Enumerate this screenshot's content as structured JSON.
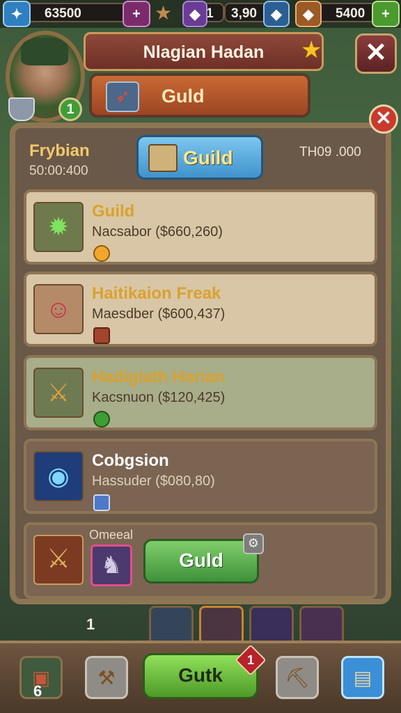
{
  "topbar": {
    "resources": [
      {
        "value": "63500",
        "icon": "gem-icon",
        "plus": "+"
      },
      {
        "value": "1",
        "icon": "amethyst-icon"
      },
      {
        "value": "3,90",
        "icon": "sapphire-icon"
      },
      {
        "value": "5400",
        "icon": "gold-crystal-icon",
        "plus": "+"
      }
    ]
  },
  "header": {
    "title": "Nlagian Hadan",
    "close": "✕"
  },
  "player": {
    "level": "1"
  },
  "tab": {
    "label": "Guld"
  },
  "guild_info": {
    "name": "Frybian",
    "sub": "50:00:400",
    "right": "TH09 .000",
    "button": "Guild",
    "close": "✕"
  },
  "entries": [
    {
      "name": "Guild",
      "meta": "Nacsabor ($660,260)",
      "icon": "compass-emblem-icon",
      "badge_color": "#f2a72c"
    },
    {
      "name": "Haitikaion Freak",
      "meta": "Maesdber ($600,437)",
      "icon": "warrior-portrait-icon",
      "badge_color": "#a3452d"
    },
    {
      "name": "Hadiglath Harian",
      "meta": "Kacsnuon ($120,425)",
      "icon": "crossed-weapons-icon",
      "badge_color": "#3e9e34"
    },
    {
      "name": "Cobgsion",
      "meta": "Hassuder ($080,80)",
      "icon": "magic-orb-icon",
      "badge_color": "#4f78c7"
    }
  ],
  "last_card": {
    "label": "Omeeal",
    "button": "Guld",
    "gear": "⚙"
  },
  "strip": {
    "count": "1"
  },
  "bottom": {
    "left_count": "6",
    "button": "Gutk",
    "badge": "1"
  },
  "colors": {
    "gold_text": "#f2c96c",
    "panel": "#6a5848",
    "header": "#8e4a3a"
  }
}
